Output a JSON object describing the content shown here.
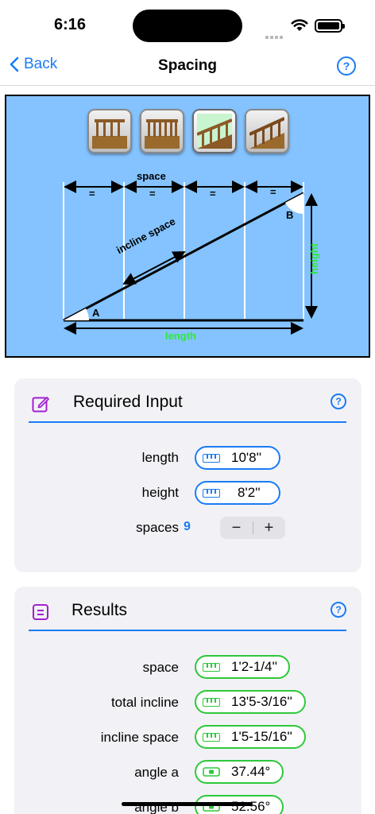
{
  "status": {
    "time": "6:16"
  },
  "nav": {
    "back_label": "Back",
    "title": "Spacing",
    "help_label": "?"
  },
  "diagram": {
    "labels": {
      "space": "space",
      "equal": "=",
      "incline_space": "incline space",
      "height": "height",
      "length": "length",
      "angle_a": "A",
      "angle_b": "B"
    },
    "tabs": [
      "flat-railing-icon",
      "flat-railing-wide-icon",
      "stair-railing-icon",
      "stair-railing-dark-icon"
    ],
    "active_tab": 2,
    "colors": {
      "background": "#84c3ff",
      "accent_label": "#2ee83a"
    }
  },
  "required_input": {
    "title": "Required Input",
    "help_label": "?",
    "fields": [
      {
        "label": "length",
        "value": "10'8''"
      },
      {
        "label": "height",
        "value": "8'2''"
      }
    ],
    "spaces": {
      "label": "spaces",
      "value": "9",
      "minus": "−",
      "plus": "+"
    }
  },
  "results": {
    "title": "Results",
    "help_label": "?",
    "rows": [
      {
        "label": "space",
        "value": "1'2-1/4''",
        "icon": "ruler-icon"
      },
      {
        "label": "total incline",
        "value": "13'5-3/16''",
        "icon": "ruler-icon"
      },
      {
        "label": "incline space",
        "value": "1'5-15/16''",
        "icon": "ruler-icon"
      },
      {
        "label": "angle a",
        "value": "37.44°",
        "icon": "level-icon"
      },
      {
        "label": "angle b",
        "value": "52.56°",
        "icon": "level-icon"
      }
    ]
  },
  "colors": {
    "accent": "#1a7cf5",
    "result": "#2ec83a",
    "card": "#f2f2f6"
  }
}
